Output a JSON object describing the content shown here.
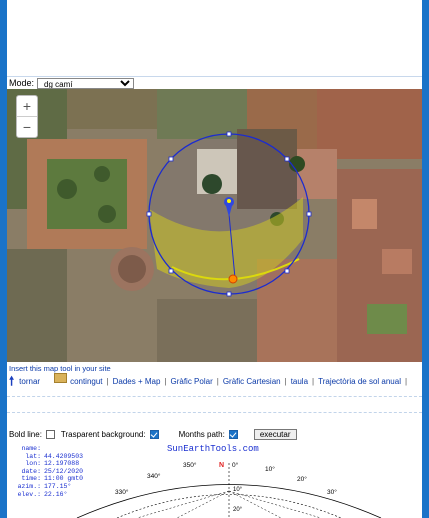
{
  "mode": {
    "label": "Mode:",
    "selected": "dg camí"
  },
  "map": {
    "zoom_in": "+",
    "zoom_out": "−"
  },
  "insert_link": "Insert this map tool in your site",
  "nav": {
    "tornar": "tornar",
    "contingut": "contingut",
    "dades_map": "Dades + Map",
    "grafic_polar": "Gràfic Polar",
    "grafic_cartesian": "Gràfic Cartesian",
    "taula": "taula",
    "trajectoria": "Trajectòria de sol anual",
    "separator": "|"
  },
  "options": {
    "bold_line": "Bold line:",
    "transparent_bg": "Trasparent background:",
    "months_path": "Months path:",
    "execute": "executar",
    "bold_line_checked": false,
    "transparent_bg_checked": true,
    "months_path_checked": true
  },
  "sun_info": {
    "name_label": "name:",
    "lat_label": "lat:",
    "lat": "44.4209503",
    "lon_label": "lon:",
    "lon": "12.197088",
    "date_label": "date:",
    "date": "25/12/2020",
    "time_label": "time:",
    "time": "11:00 gmt0",
    "azim_label": "azim.:",
    "azim": "177.15°",
    "elev_label": "elev.:",
    "elev": "22.16°"
  },
  "site_name": "SunEarthTools.com",
  "polar_labels": {
    "a340": "340°",
    "a350": "350°",
    "north": "N",
    "a0": "0°",
    "a10": "10°",
    "a20": "20°",
    "a330": "330°",
    "a30": "30°",
    "r10": "10°",
    "r20": "20°"
  },
  "colors": {
    "frame": "#1a73c8",
    "link": "#0b3aa8",
    "info_text": "#1a2fd0",
    "north": "#e02020"
  }
}
